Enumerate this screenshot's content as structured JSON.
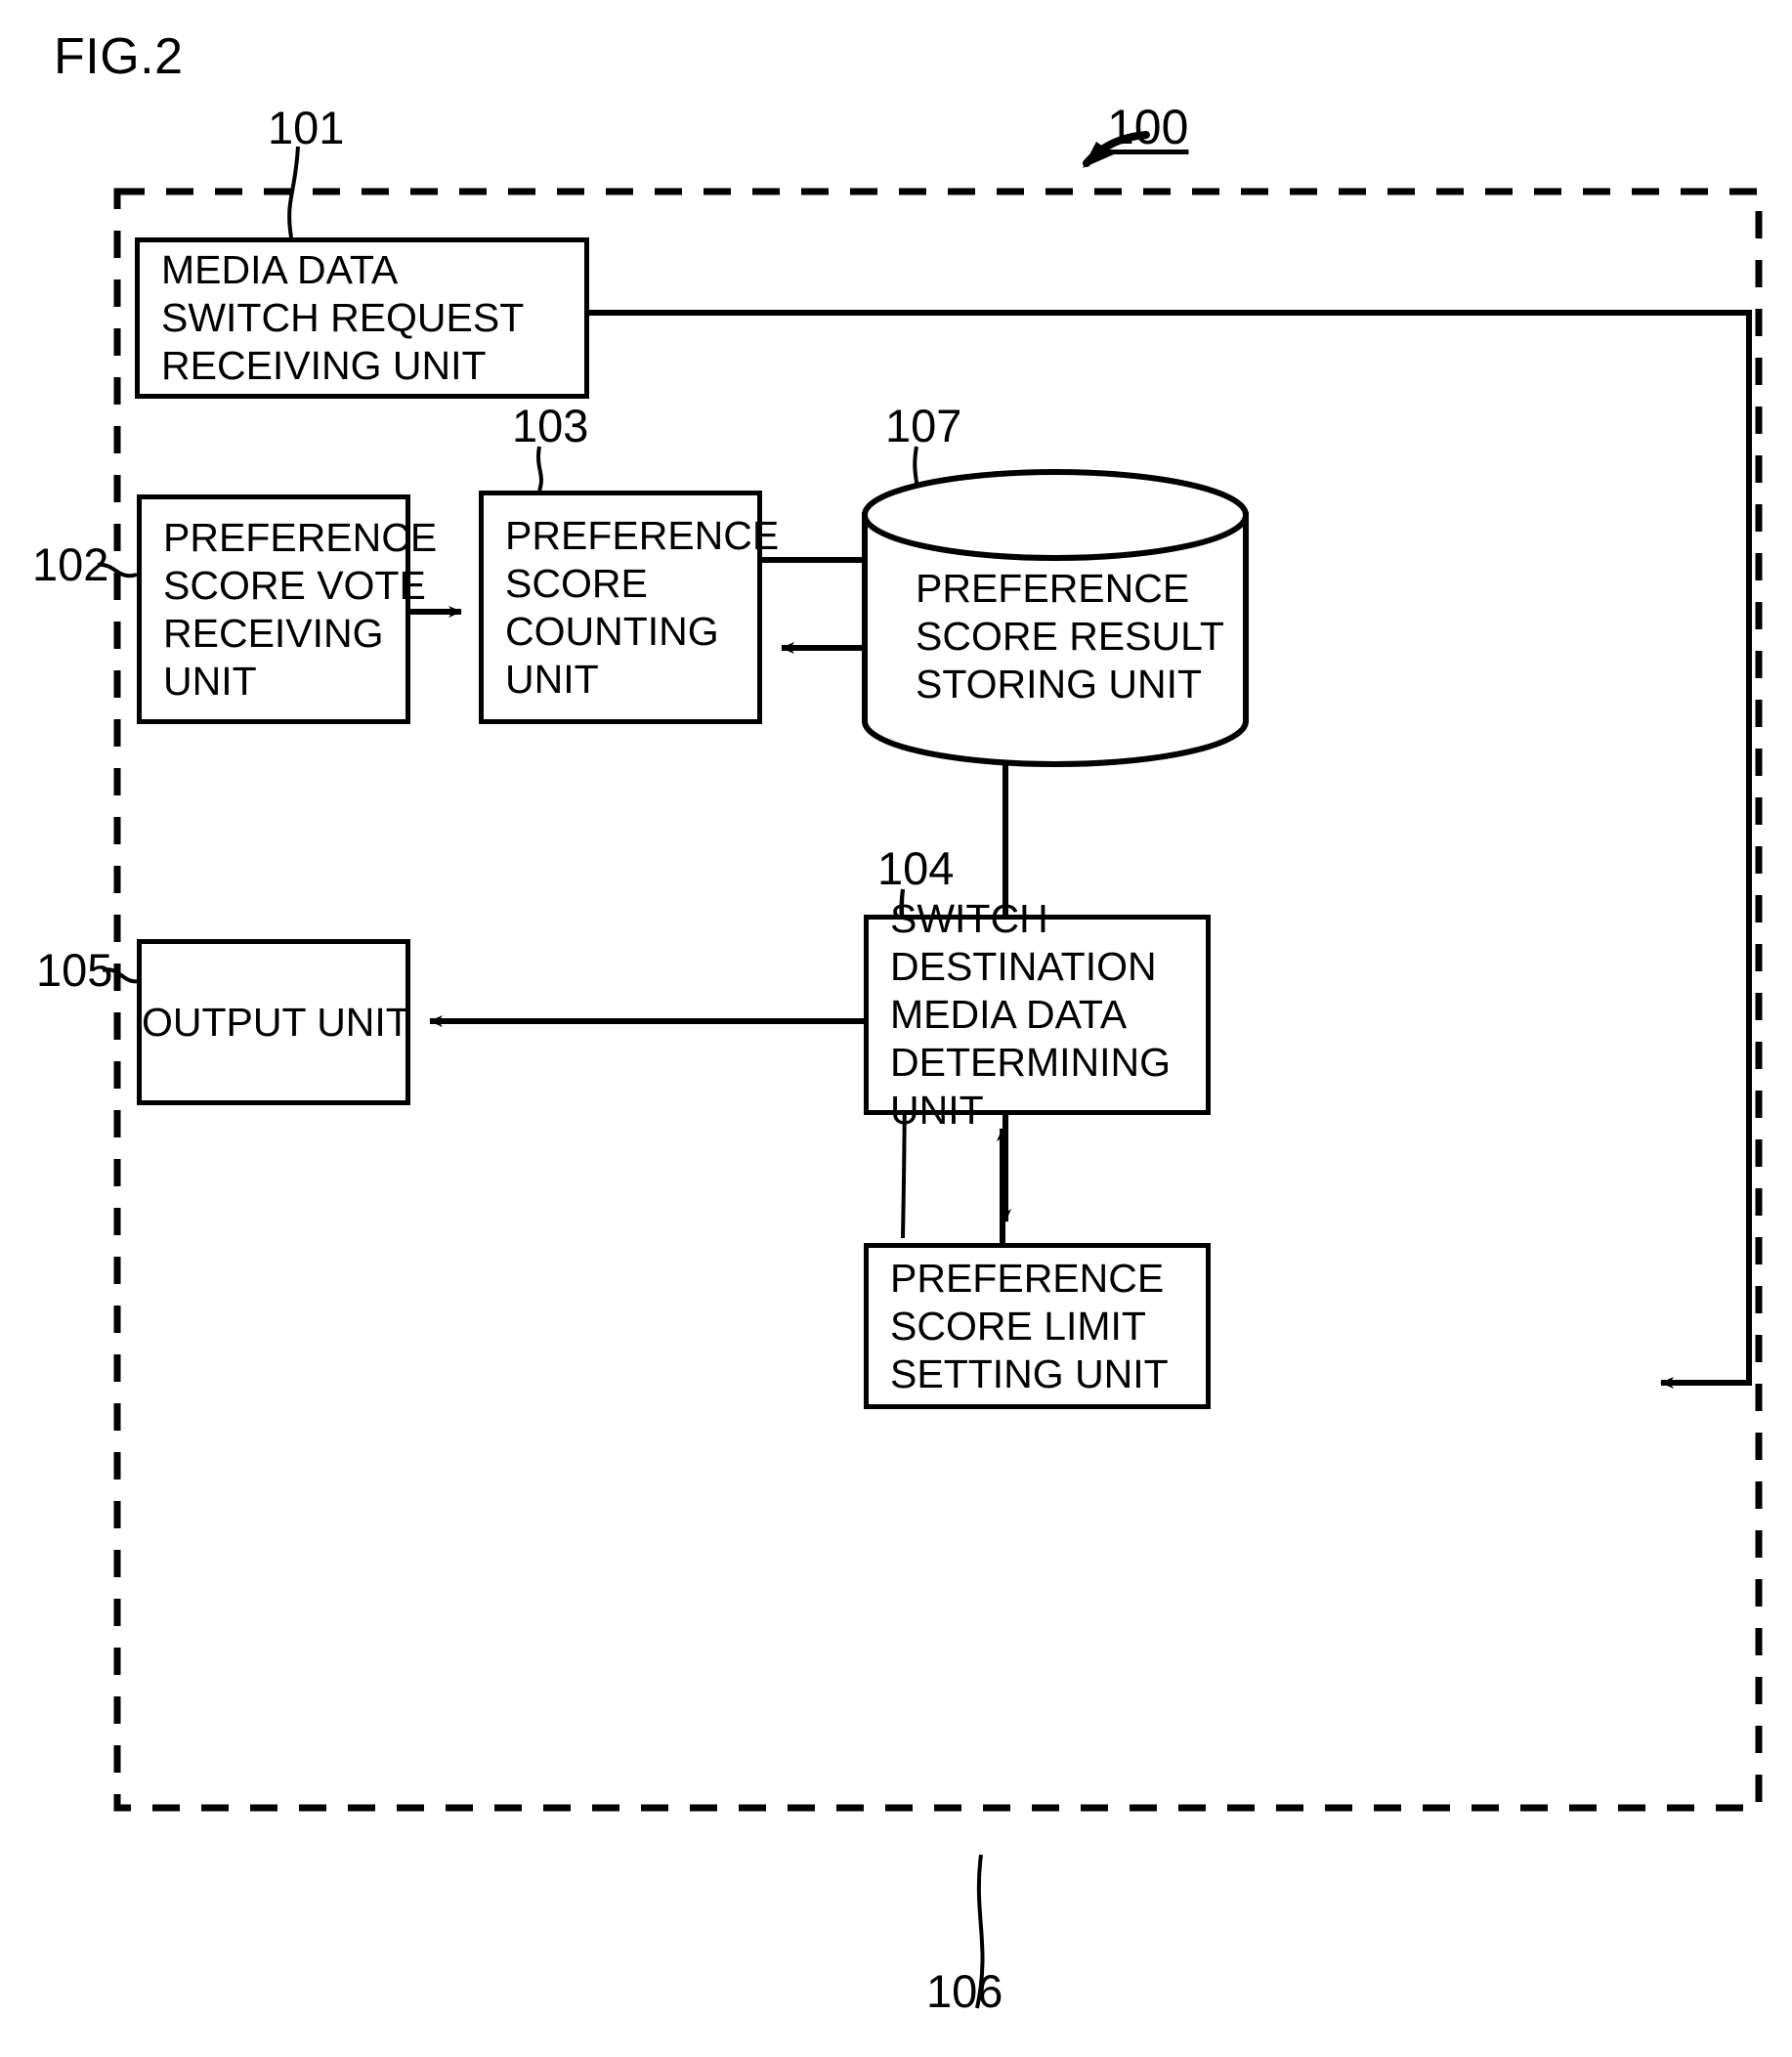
{
  "figure": {
    "title": "FIG.2",
    "system_reference": "100"
  },
  "references": {
    "r101": "101",
    "r102": "102",
    "r103": "103",
    "r104": "104",
    "r105": "105",
    "r106": "106",
    "r107": "107"
  },
  "blocks": {
    "media_data_switch_request_receiving_unit": {
      "ref": "101",
      "lines": [
        "MEDIA DATA",
        "SWITCH REQUEST",
        "RECEIVING UNIT"
      ]
    },
    "preference_score_vote_receiving_unit": {
      "ref": "102",
      "lines": [
        "PREFERENCE",
        "SCORE VOTE",
        "RECEIVING",
        "UNIT"
      ]
    },
    "preference_score_counting_unit": {
      "ref": "103",
      "lines": [
        "PREFERENCE",
        "SCORE",
        "COUNTING",
        "UNIT"
      ]
    },
    "switch_destination_media_data_determining_unit": {
      "ref": "104",
      "lines": [
        "SWITCH",
        "DESTINATION",
        "MEDIA DATA",
        "DETERMINING",
        "UNIT"
      ]
    },
    "output_unit": {
      "ref": "105",
      "lines": [
        "OUTPUT UNIT"
      ]
    },
    "preference_score_limit_setting_unit": {
      "ref": "106",
      "lines": [
        "PREFERENCE",
        "SCORE LIMIT",
        "SETTING UNIT"
      ]
    },
    "preference_score_result_storing_unit": {
      "ref": "107",
      "shape": "cylinder",
      "lines": [
        "PREFERENCE",
        "SCORE RESULT",
        "STORING UNIT"
      ]
    }
  },
  "connections": [
    {
      "name": "vote-receiving-to-counting",
      "from": "102",
      "to": "103",
      "arrow": "right"
    },
    {
      "name": "counting-to-storing",
      "from": "103",
      "to": "107",
      "arrow": "right"
    },
    {
      "name": "storing-to-counting",
      "from": "107",
      "to": "103",
      "arrow": "left"
    },
    {
      "name": "storing-to-determining",
      "from": "107",
      "to": "104",
      "arrow": "down"
    },
    {
      "name": "determining-to-output",
      "from": "104",
      "to": "105",
      "arrow": "left"
    },
    {
      "name": "limit-setting-to-determining",
      "from": "106",
      "to": "104",
      "arrow": "up"
    },
    {
      "name": "switch-request-to-determining",
      "from": "101",
      "to": "104",
      "arrow": "left"
    }
  ],
  "colors": {
    "stroke": "#000000",
    "background": "#ffffff"
  }
}
